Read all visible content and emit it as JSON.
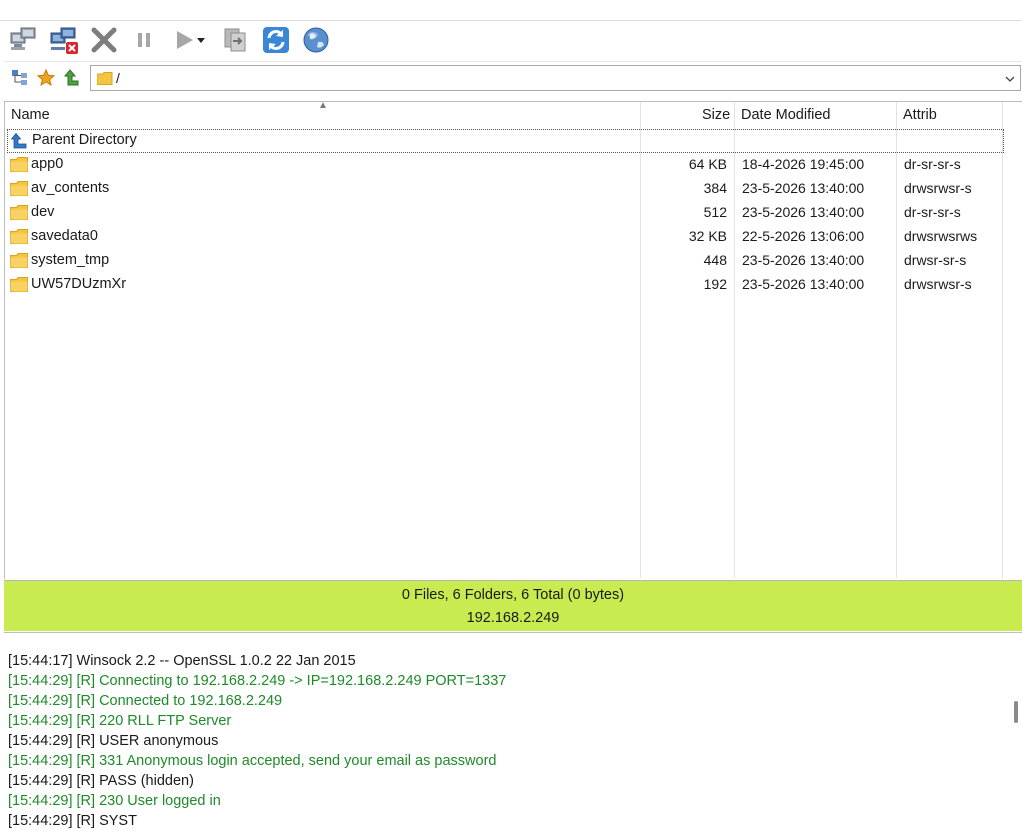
{
  "address": {
    "path": "/"
  },
  "columns": {
    "name": "Name",
    "size": "Size",
    "date": "Date Modified",
    "attrib": "Attrib"
  },
  "parent": {
    "label": "Parent Directory"
  },
  "files": [
    {
      "name": "app0",
      "size": "64 KB",
      "date": "18-4-2026 19:45:00",
      "attrib": "dr-sr-sr-s"
    },
    {
      "name": "av_contents",
      "size": "384",
      "date": "23-5-2026 13:40:00",
      "attrib": "drwsrwsr-s"
    },
    {
      "name": "dev",
      "size": "512",
      "date": "23-5-2026 13:40:00",
      "attrib": "dr-sr-sr-s"
    },
    {
      "name": "savedata0",
      "size": "32 KB",
      "date": "22-5-2026 13:06:00",
      "attrib": "drwsrwsrws"
    },
    {
      "name": "system_tmp",
      "size": "448",
      "date": "23-5-2026 13:40:00",
      "attrib": "drwsr-sr-s"
    },
    {
      "name": "UW57DUzmXr",
      "size": "192",
      "date": "23-5-2026 13:40:00",
      "attrib": "drwsrwsr-s"
    }
  ],
  "status": {
    "summary": "0 Files, 6 Folders, 6 Total (0 bytes)",
    "host": "192.168.2.249"
  },
  "log": [
    {
      "text": "[15:44:17]  Winsock 2.2 -- OpenSSL 1.0.2 22 Jan 2015",
      "color": "#1a1a1a"
    },
    {
      "text": "[15:44:29]  [R] Connecting to 192.168.2.249 -> IP=192.168.2.249 PORT=1337",
      "color": "#1f8a2a"
    },
    {
      "text": "[15:44:29]  [R] Connected to 192.168.2.249",
      "color": "#1f8a2a"
    },
    {
      "text": "[15:44:29]  [R] 220 RLL FTP Server",
      "color": "#1f8a2a"
    },
    {
      "text": "[15:44:29]  [R] USER anonymous",
      "color": "#1a1a1a"
    },
    {
      "text": "[15:44:29]  [R] 331 Anonymous login accepted, send your email as password",
      "color": "#1f8a2a"
    },
    {
      "text": "[15:44:29]  [R] PASS (hidden)",
      "color": "#1a1a1a"
    },
    {
      "text": "[15:44:29]  [R] 230 User logged in",
      "color": "#1f8a2a"
    },
    {
      "text": "[15:44:29]  [R] SYST",
      "color": "#1a1a1a"
    }
  ],
  "colors": {
    "status_bg": "#c8ec50",
    "log_green": "#1f8a2a",
    "folder": "#f5c542"
  }
}
